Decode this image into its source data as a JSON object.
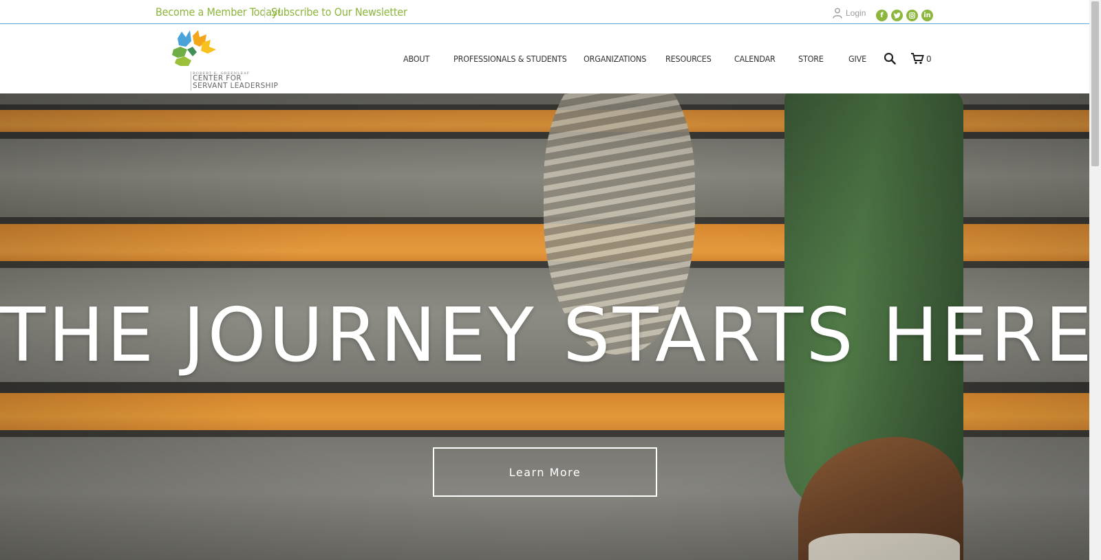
{
  "topbar": {
    "member_link": "Become a Member Today!",
    "newsletter_link": "Subscribe to Our Newsletter",
    "login_label": "Login",
    "social": [
      "facebook-icon",
      "twitter-icon",
      "instagram-icon",
      "linkedin-icon"
    ]
  },
  "logo": {
    "small_text": "ROBERT K. GREENLEAF",
    "line1": "CENTER FOR",
    "line2": "SERVANT LEADERSHIP"
  },
  "nav": {
    "items": [
      "ABOUT",
      "PROFESSIONALS & STUDENTS",
      "ORGANIZATIONS",
      "RESOURCES",
      "CALENDAR",
      "STORE",
      "GIVE"
    ],
    "cart_count": "0"
  },
  "hero": {
    "title": "THE JOURNEY STARTS HERE",
    "button_label": "Learn More"
  },
  "colors": {
    "accent_green": "#8cb63c",
    "divider_blue": "#5ea8d4"
  }
}
